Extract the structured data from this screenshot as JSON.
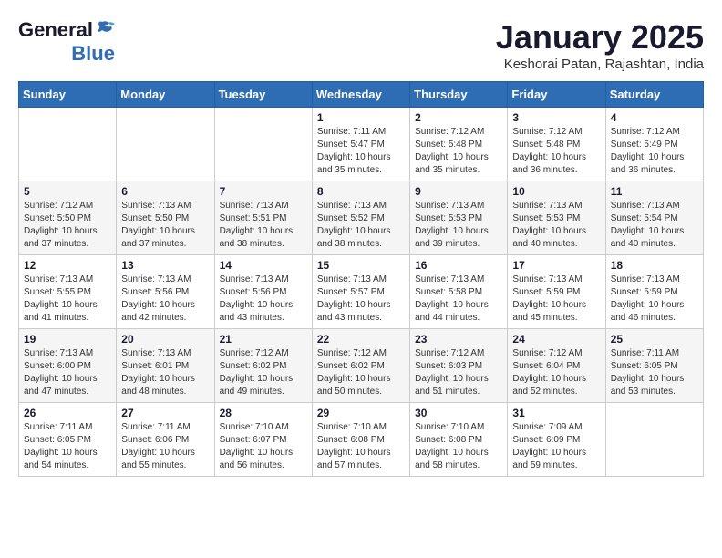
{
  "header": {
    "logo_general": "General",
    "logo_blue": "Blue",
    "month_title": "January 2025",
    "location": "Keshorai Patan, Rajashtan, India"
  },
  "weekdays": [
    "Sunday",
    "Monday",
    "Tuesday",
    "Wednesday",
    "Thursday",
    "Friday",
    "Saturday"
  ],
  "weeks": [
    [
      {
        "day": "",
        "sunrise": "",
        "sunset": "",
        "daylight": ""
      },
      {
        "day": "",
        "sunrise": "",
        "sunset": "",
        "daylight": ""
      },
      {
        "day": "",
        "sunrise": "",
        "sunset": "",
        "daylight": ""
      },
      {
        "day": "1",
        "sunrise": "Sunrise: 7:11 AM",
        "sunset": "Sunset: 5:47 PM",
        "daylight": "Daylight: 10 hours and 35 minutes."
      },
      {
        "day": "2",
        "sunrise": "Sunrise: 7:12 AM",
        "sunset": "Sunset: 5:48 PM",
        "daylight": "Daylight: 10 hours and 35 minutes."
      },
      {
        "day": "3",
        "sunrise": "Sunrise: 7:12 AM",
        "sunset": "Sunset: 5:48 PM",
        "daylight": "Daylight: 10 hours and 36 minutes."
      },
      {
        "day": "4",
        "sunrise": "Sunrise: 7:12 AM",
        "sunset": "Sunset: 5:49 PM",
        "daylight": "Daylight: 10 hours and 36 minutes."
      }
    ],
    [
      {
        "day": "5",
        "sunrise": "Sunrise: 7:12 AM",
        "sunset": "Sunset: 5:50 PM",
        "daylight": "Daylight: 10 hours and 37 minutes."
      },
      {
        "day": "6",
        "sunrise": "Sunrise: 7:13 AM",
        "sunset": "Sunset: 5:50 PM",
        "daylight": "Daylight: 10 hours and 37 minutes."
      },
      {
        "day": "7",
        "sunrise": "Sunrise: 7:13 AM",
        "sunset": "Sunset: 5:51 PM",
        "daylight": "Daylight: 10 hours and 38 minutes."
      },
      {
        "day": "8",
        "sunrise": "Sunrise: 7:13 AM",
        "sunset": "Sunset: 5:52 PM",
        "daylight": "Daylight: 10 hours and 38 minutes."
      },
      {
        "day": "9",
        "sunrise": "Sunrise: 7:13 AM",
        "sunset": "Sunset: 5:53 PM",
        "daylight": "Daylight: 10 hours and 39 minutes."
      },
      {
        "day": "10",
        "sunrise": "Sunrise: 7:13 AM",
        "sunset": "Sunset: 5:53 PM",
        "daylight": "Daylight: 10 hours and 40 minutes."
      },
      {
        "day": "11",
        "sunrise": "Sunrise: 7:13 AM",
        "sunset": "Sunset: 5:54 PM",
        "daylight": "Daylight: 10 hours and 40 minutes."
      }
    ],
    [
      {
        "day": "12",
        "sunrise": "Sunrise: 7:13 AM",
        "sunset": "Sunset: 5:55 PM",
        "daylight": "Daylight: 10 hours and 41 minutes."
      },
      {
        "day": "13",
        "sunrise": "Sunrise: 7:13 AM",
        "sunset": "Sunset: 5:56 PM",
        "daylight": "Daylight: 10 hours and 42 minutes."
      },
      {
        "day": "14",
        "sunrise": "Sunrise: 7:13 AM",
        "sunset": "Sunset: 5:56 PM",
        "daylight": "Daylight: 10 hours and 43 minutes."
      },
      {
        "day": "15",
        "sunrise": "Sunrise: 7:13 AM",
        "sunset": "Sunset: 5:57 PM",
        "daylight": "Daylight: 10 hours and 43 minutes."
      },
      {
        "day": "16",
        "sunrise": "Sunrise: 7:13 AM",
        "sunset": "Sunset: 5:58 PM",
        "daylight": "Daylight: 10 hours and 44 minutes."
      },
      {
        "day": "17",
        "sunrise": "Sunrise: 7:13 AM",
        "sunset": "Sunset: 5:59 PM",
        "daylight": "Daylight: 10 hours and 45 minutes."
      },
      {
        "day": "18",
        "sunrise": "Sunrise: 7:13 AM",
        "sunset": "Sunset: 5:59 PM",
        "daylight": "Daylight: 10 hours and 46 minutes."
      }
    ],
    [
      {
        "day": "19",
        "sunrise": "Sunrise: 7:13 AM",
        "sunset": "Sunset: 6:00 PM",
        "daylight": "Daylight: 10 hours and 47 minutes."
      },
      {
        "day": "20",
        "sunrise": "Sunrise: 7:13 AM",
        "sunset": "Sunset: 6:01 PM",
        "daylight": "Daylight: 10 hours and 48 minutes."
      },
      {
        "day": "21",
        "sunrise": "Sunrise: 7:12 AM",
        "sunset": "Sunset: 6:02 PM",
        "daylight": "Daylight: 10 hours and 49 minutes."
      },
      {
        "day": "22",
        "sunrise": "Sunrise: 7:12 AM",
        "sunset": "Sunset: 6:02 PM",
        "daylight": "Daylight: 10 hours and 50 minutes."
      },
      {
        "day": "23",
        "sunrise": "Sunrise: 7:12 AM",
        "sunset": "Sunset: 6:03 PM",
        "daylight": "Daylight: 10 hours and 51 minutes."
      },
      {
        "day": "24",
        "sunrise": "Sunrise: 7:12 AM",
        "sunset": "Sunset: 6:04 PM",
        "daylight": "Daylight: 10 hours and 52 minutes."
      },
      {
        "day": "25",
        "sunrise": "Sunrise: 7:11 AM",
        "sunset": "Sunset: 6:05 PM",
        "daylight": "Daylight: 10 hours and 53 minutes."
      }
    ],
    [
      {
        "day": "26",
        "sunrise": "Sunrise: 7:11 AM",
        "sunset": "Sunset: 6:05 PM",
        "daylight": "Daylight: 10 hours and 54 minutes."
      },
      {
        "day": "27",
        "sunrise": "Sunrise: 7:11 AM",
        "sunset": "Sunset: 6:06 PM",
        "daylight": "Daylight: 10 hours and 55 minutes."
      },
      {
        "day": "28",
        "sunrise": "Sunrise: 7:10 AM",
        "sunset": "Sunset: 6:07 PM",
        "daylight": "Daylight: 10 hours and 56 minutes."
      },
      {
        "day": "29",
        "sunrise": "Sunrise: 7:10 AM",
        "sunset": "Sunset: 6:08 PM",
        "daylight": "Daylight: 10 hours and 57 minutes."
      },
      {
        "day": "30",
        "sunrise": "Sunrise: 7:10 AM",
        "sunset": "Sunset: 6:08 PM",
        "daylight": "Daylight: 10 hours and 58 minutes."
      },
      {
        "day": "31",
        "sunrise": "Sunrise: 7:09 AM",
        "sunset": "Sunset: 6:09 PM",
        "daylight": "Daylight: 10 hours and 59 minutes."
      },
      {
        "day": "",
        "sunrise": "",
        "sunset": "",
        "daylight": ""
      }
    ]
  ]
}
